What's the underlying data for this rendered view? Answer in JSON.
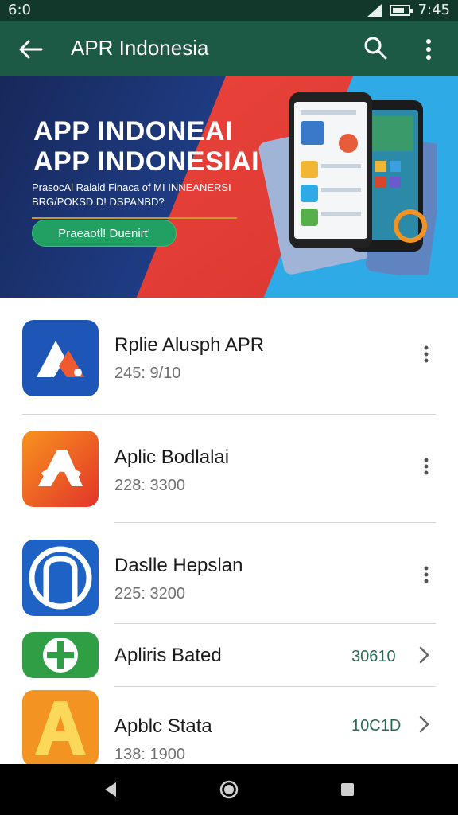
{
  "status_bar": {
    "time_left": "6:0",
    "time_right": "7:45",
    "battery_level": 0.75
  },
  "app_bar": {
    "title": "APR Indonesia",
    "icons": [
      "back-arrow-icon",
      "search-icon",
      "more-vertical-icon"
    ]
  },
  "banner": {
    "heading_1": "APP INDONEAI",
    "heading_2": "APP INDONESIAI",
    "subtitle_1": "PrasocAl Ralald Finaca of MI INNEANERSI",
    "subtitle_2": "BRG/POKSD D! DSPANBD?",
    "cta_label": "Praeaotl! Duenirt'",
    "colors": {
      "background": "#1f3d86",
      "red": "#e8423a",
      "cyan": "#2eaae6",
      "cta": "#22a063"
    }
  },
  "apps": [
    {
      "name": "Rplie Alusph APR",
      "meta": "245: 9/10",
      "action": "more-vertical-icon",
      "icon_color": "#1e56b8"
    },
    {
      "name": "Aplic Bodlalai",
      "meta": "228: 3300",
      "action": "more-vertical-icon",
      "icon_color": "#ef5a1e"
    },
    {
      "name": "Daslle Hepslan",
      "meta": "225: 3200",
      "action": "more-vertical-icon",
      "icon_color": "#1d62c4"
    },
    {
      "name": "Apliris Bated",
      "meta": "",
      "value": "30610",
      "action": "chevron-right-icon",
      "icon_color": "#2f9e45"
    },
    {
      "name": "Apblc Stata",
      "meta": "138: 1900",
      "value": "10C1D",
      "action": "chevron-right-icon",
      "icon_color": "#f39322"
    }
  ],
  "nav_bar": {
    "icons": [
      "back-triangle-icon",
      "home-circle-icon",
      "recents-square-icon"
    ]
  }
}
